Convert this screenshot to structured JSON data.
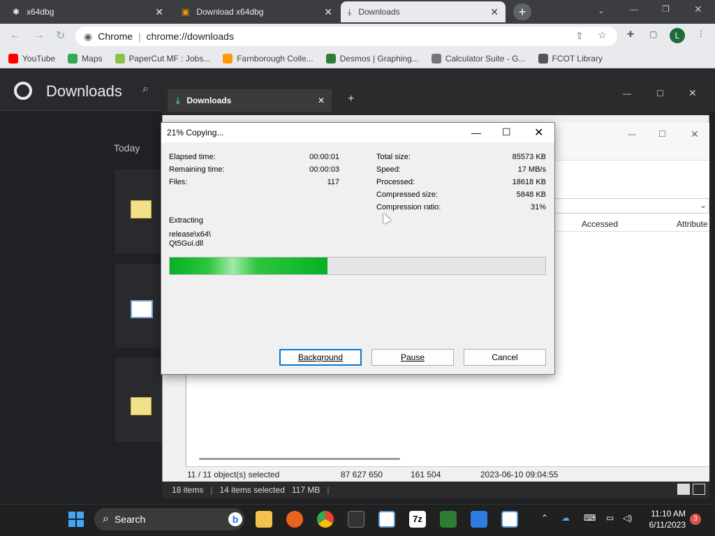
{
  "browser": {
    "tabs": [
      {
        "label": "x64dbg",
        "icon": "bug-icon"
      },
      {
        "label": "Download x64dbg",
        "icon": "page-icon"
      },
      {
        "label": "Downloads",
        "icon": "download-icon"
      }
    ],
    "address_prefix": "Chrome",
    "address": "chrome://downloads",
    "bookmarks": [
      {
        "label": "YouTube",
        "color": "#ff0000"
      },
      {
        "label": "Maps",
        "color": "#34a853"
      },
      {
        "label": "PaperCut MF : Jobs...",
        "color": "#8bc34a"
      },
      {
        "label": "Farnborough Colle...",
        "color": "#ff9800"
      },
      {
        "label": "Desmos | Graphing...",
        "color": "#2e7d32"
      },
      {
        "label": "Calculator Suite - G...",
        "color": "#757575"
      },
      {
        "label": "FCOT Library",
        "color": "#555555"
      }
    ],
    "profile_initial": "L"
  },
  "downloads_page": {
    "title": "Downloads",
    "section": "Today"
  },
  "zip_window": {
    "tab_label": "Downloads",
    "columns": {
      "accessed": "Accessed",
      "attributes": "Attribute"
    },
    "status": {
      "selected": "11 / 11 object(s) selected",
      "size": "87 627 650",
      "packed": "161 504",
      "date": "2023-06-10 09:04:55"
    },
    "bottom": {
      "items": "18 items",
      "selected": "14 items selected",
      "size": "117 MB"
    }
  },
  "dialog": {
    "title": "21% Copying...",
    "left": [
      {
        "label": "Elapsed time:",
        "value": "00:00:01"
      },
      {
        "label": "Remaining time:",
        "value": "00:00:03"
      },
      {
        "label": "Files:",
        "value": "117"
      }
    ],
    "right": [
      {
        "label": "Total size:",
        "value": "85573 KB"
      },
      {
        "label": "Speed:",
        "value": "17 MB/s"
      },
      {
        "label": "Processed:",
        "value": "18618 KB"
      },
      {
        "label": "Compressed size:",
        "value": "5848 KB"
      },
      {
        "label": "Compression ratio:",
        "value": "31%"
      }
    ],
    "operation": "Extracting",
    "path_line1": "release\\x64\\",
    "path_line2": "Qt5Gui.dll",
    "progress": 0.42,
    "buttons": {
      "background": "Background",
      "pause": "Pause",
      "cancel": "Cancel"
    }
  },
  "taskbar": {
    "search": "Search",
    "time": "11:10 AM",
    "date": "6/11/2023",
    "badge": "3"
  }
}
